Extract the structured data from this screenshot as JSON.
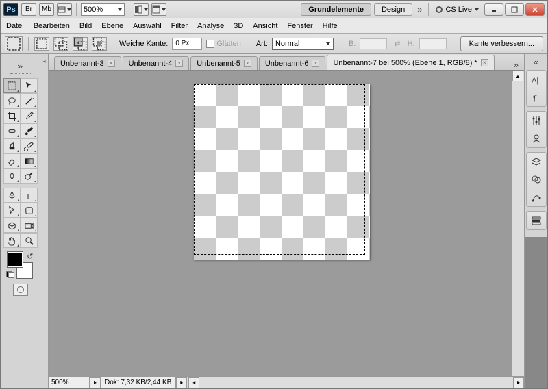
{
  "titlebar": {
    "zoom_value": "500%",
    "workspace_active": "Grundelemente",
    "workspace_other": "Design",
    "cslive": "CS Live"
  },
  "menu": {
    "datei": "Datei",
    "bearbeiten": "Bearbeiten",
    "bild": "Bild",
    "ebene": "Ebene",
    "auswahl": "Auswahl",
    "filter": "Filter",
    "analyse": "Analyse",
    "threeD": "3D",
    "ansicht": "Ansicht",
    "fenster": "Fenster",
    "hilfe": "Hilfe"
  },
  "options": {
    "weiche_kante_label": "Weiche Kante:",
    "weiche_kante_value": "0 Px",
    "glaetten": "Glätten",
    "art_label": "Art:",
    "art_value": "Normal",
    "breite_label": "B:",
    "hoehe_label": "H:",
    "refine": "Kante verbessern..."
  },
  "tabs": {
    "t1": "Unbenannt-3",
    "t2": "Unbenannt-4",
    "t3": "Unbenannt-5",
    "t4": "Unbenannt-6",
    "t5": "Unbenannt-7 bei 500% (Ebene 1, RGB/8) *"
  },
  "status": {
    "zoom": "500%",
    "dok": "Dok: 7,32 KB/2,44 KB"
  },
  "icons": {
    "br": "Br",
    "mb": "Mb"
  }
}
